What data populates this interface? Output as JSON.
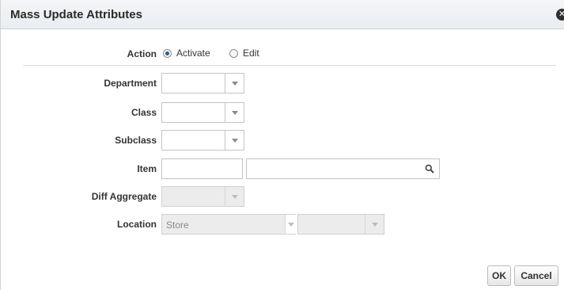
{
  "dialog": {
    "title": "Mass Update Attributes",
    "close_icon": "close-icon"
  },
  "form": {
    "action": {
      "label": "Action",
      "options": [
        {
          "label": "Activate",
          "selected": true
        },
        {
          "label": "Edit",
          "selected": false
        }
      ]
    },
    "department": {
      "label": "Department",
      "value": ""
    },
    "class": {
      "label": "Class",
      "value": ""
    },
    "subclass": {
      "label": "Subclass",
      "value": ""
    },
    "item": {
      "label": "Item",
      "value": "",
      "description": ""
    },
    "diff_aggregate": {
      "label": "Diff Aggregate",
      "value": "",
      "disabled": true
    },
    "location": {
      "label": "Location",
      "type_value": "Store",
      "value": "",
      "disabled": true
    }
  },
  "footer": {
    "ok_label": "OK",
    "cancel_label": "Cancel"
  },
  "colors": {
    "titlebar": "#e9edf1",
    "radio_selected": "#2f5c8f",
    "disabled_bg": "#ececec"
  }
}
